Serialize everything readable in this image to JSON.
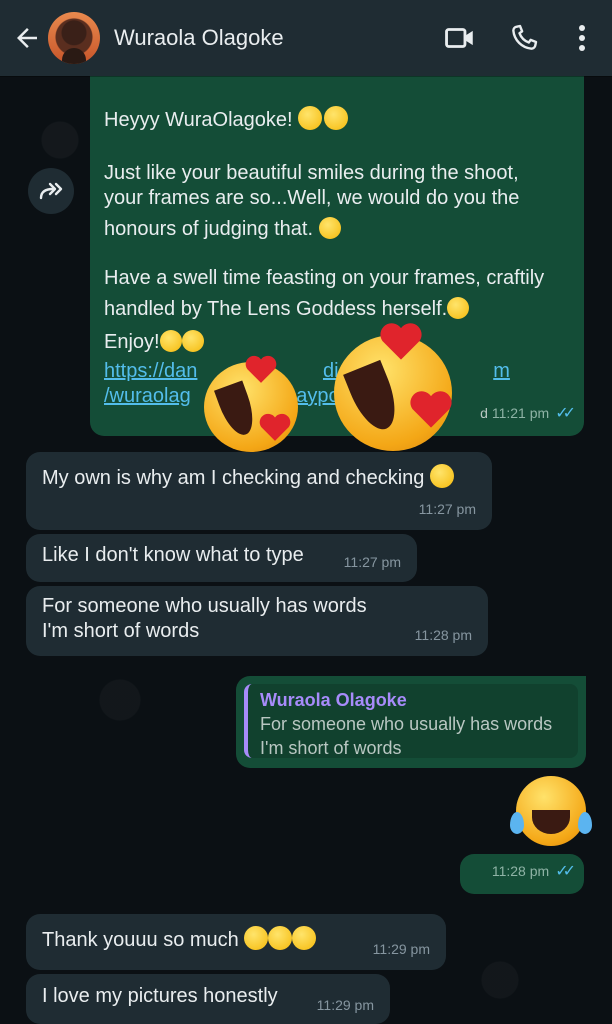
{
  "header": {
    "contact_name": "Wuraola Olagoke"
  },
  "messages": {
    "forwarded": {
      "greeting": "Heyyy WuraOlagoke!",
      "p1_line1": "Just like your beautiful smiles during the shoot,",
      "p1_line2": "your frames are so...Well, we would do you the",
      "p1_line3": "honours of judging that.",
      "p2_line1": "Have a swell time feasting on your frames, craftily",
      "p2_line2": "handled by The Lens Goddess herself.",
      "enjoy": "Enjoy!",
      "link_line1": "https://dan",
      "link_line1_tail": "dios",
      "link_line1_end": "m",
      "link_line2": "/wuraolag",
      "link_line2_tail": "aypo",
      "edited": "d",
      "time": "11:21 pm"
    },
    "m1": {
      "text": "My own is why am I checking and checking",
      "time": "11:27 pm"
    },
    "m2": {
      "text": "Like I don't know what to type",
      "time": "11:27 pm"
    },
    "m3": {
      "line1": "For someone who usually has words",
      "line2": "I'm short of words",
      "time": "11:28 pm"
    },
    "reply": {
      "quote_name": "Wuraola Olagoke",
      "quote_line1": "For someone who usually has words",
      "quote_line2": "I'm short of words"
    },
    "reply_time": "11:28 pm",
    "m4": {
      "text": "Thank youuu so much",
      "time": "11:29 pm"
    },
    "m5": {
      "text": "I love my pictures honestly",
      "time": "11:29 pm"
    }
  },
  "colors": {
    "header_bg": "#1f2c33",
    "incoming_bg": "#1f2c33",
    "outgoing_bg": "#144d37",
    "read_ticks": "#53bdeb",
    "quote_accent": "#a78bfa"
  }
}
